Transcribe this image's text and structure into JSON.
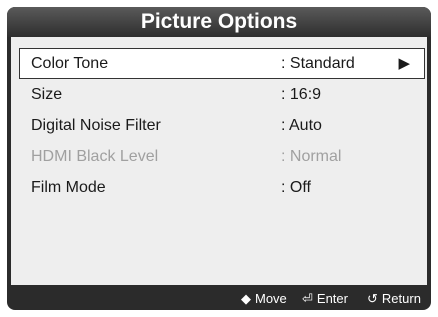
{
  "title": "Picture Options",
  "items": [
    {
      "label": "Color Tone",
      "value": ": Standard",
      "arrow": "▶"
    },
    {
      "label": "Size",
      "value": ": 16:9"
    },
    {
      "label": "Digital Noise Filter",
      "value": ": Auto"
    },
    {
      "label": "HDMI Black Level",
      "value": ": Normal"
    },
    {
      "label": "Film Mode",
      "value": ": Off"
    }
  ],
  "footer": {
    "move": {
      "icon": "move-icon",
      "glyph": "◆",
      "label": "Move"
    },
    "enter": {
      "icon": "enter-icon",
      "glyph": "⏎",
      "label": "Enter"
    },
    "return": {
      "icon": "return-icon",
      "glyph": "↺",
      "label": "Return"
    }
  }
}
